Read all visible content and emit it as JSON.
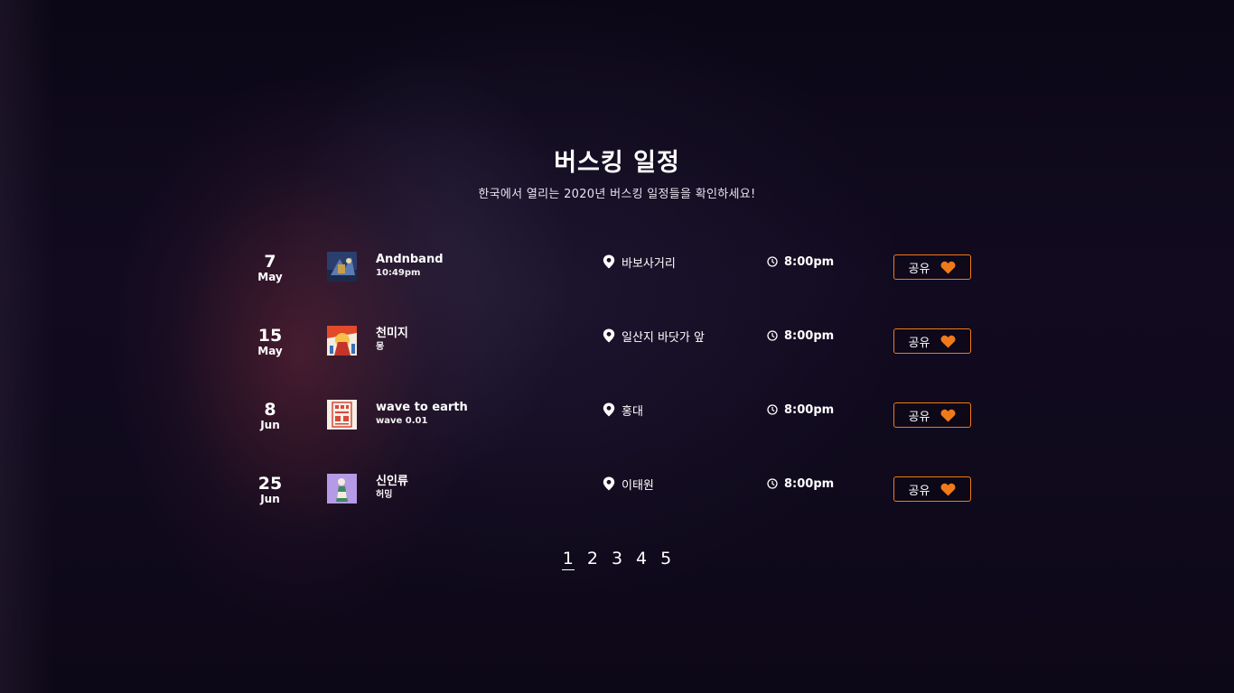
{
  "header": {
    "title": "버스킹 일정",
    "subtitle": "한국에서 열리는 2020년 버스킹 일정들을 확인하세요!"
  },
  "accent_color": "#f07a1a",
  "events": [
    {
      "day": "7",
      "month": "May",
      "artist": "Andnband",
      "song": "10:49pm",
      "location": "바보사거리",
      "time": "8:00pm",
      "share_label": "공유",
      "thumb_icon": "album-art-andnband"
    },
    {
      "day": "15",
      "month": "May",
      "artist": "천미지",
      "song": "몽",
      "location": "일산지 바닷가 앞",
      "time": "8:00pm",
      "share_label": "공유",
      "thumb_icon": "album-art-cheonmiji"
    },
    {
      "day": "8",
      "month": "Jun",
      "artist": "wave to earth",
      "song": "wave 0.01",
      "location": "홍대",
      "time": "8:00pm",
      "share_label": "공유",
      "thumb_icon": "album-art-wave-to-earth"
    },
    {
      "day": "25",
      "month": "Jun",
      "artist": "신인류",
      "song": "허밍",
      "location": "이태원",
      "time": "8:00pm",
      "share_label": "공유",
      "thumb_icon": "album-art-sininryu"
    }
  ],
  "pagination": {
    "pages": [
      "1",
      "2",
      "3",
      "4",
      "5"
    ],
    "current": "1"
  }
}
